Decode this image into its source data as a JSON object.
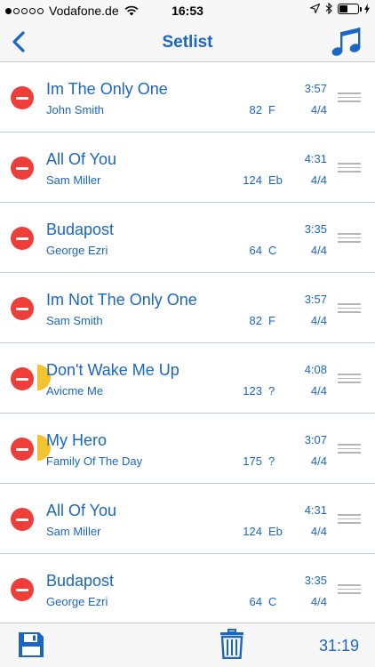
{
  "status": {
    "carrier": "Vodafone.de",
    "time": "16:53",
    "signal_bars": 1
  },
  "nav": {
    "title": "Setlist",
    "back_icon": "chevron-left-icon",
    "right_icon": "music-note-icon"
  },
  "songs": [
    {
      "title": "Im The Only One",
      "artist": "John Smith",
      "duration": "3:57",
      "bpm": "82",
      "key": "F",
      "signature": "4/4",
      "marked": false
    },
    {
      "title": "All Of You",
      "artist": "Sam Miller",
      "duration": "4:31",
      "bpm": "124",
      "key": "Eb",
      "signature": "4/4",
      "marked": false
    },
    {
      "title": "Budapost",
      "artist": "George Ezri",
      "duration": "3:35",
      "bpm": "64",
      "key": "C",
      "signature": "4/4",
      "marked": false
    },
    {
      "title": "Im Not The Only One",
      "artist": "Sam Smith",
      "duration": "3:57",
      "bpm": "82",
      "key": "F",
      "signature": "4/4",
      "marked": false
    },
    {
      "title": "Don't Wake Me Up",
      "artist": "Avicme Me",
      "duration": "4:08",
      "bpm": "123",
      "key": "?",
      "signature": "4/4",
      "marked": true
    },
    {
      "title": "My Hero",
      "artist": "Family Of The Day",
      "duration": "3:07",
      "bpm": "175",
      "key": "?",
      "signature": "4/4",
      "marked": true
    },
    {
      "title": "All Of You",
      "artist": "Sam Miller",
      "duration": "4:31",
      "bpm": "124",
      "key": "Eb",
      "signature": "4/4",
      "marked": false
    },
    {
      "title": "Budapost",
      "artist": "George Ezri",
      "duration": "3:35",
      "bpm": "64",
      "key": "C",
      "signature": "4/4",
      "marked": false
    }
  ],
  "toolbar": {
    "save_icon": "floppy-disk-icon",
    "trash_icon": "trash-icon",
    "total_duration": "31:19"
  },
  "colors": {
    "accent": "#1a66c2",
    "delete": "#ef3e3a",
    "marker": "#f4c430"
  }
}
